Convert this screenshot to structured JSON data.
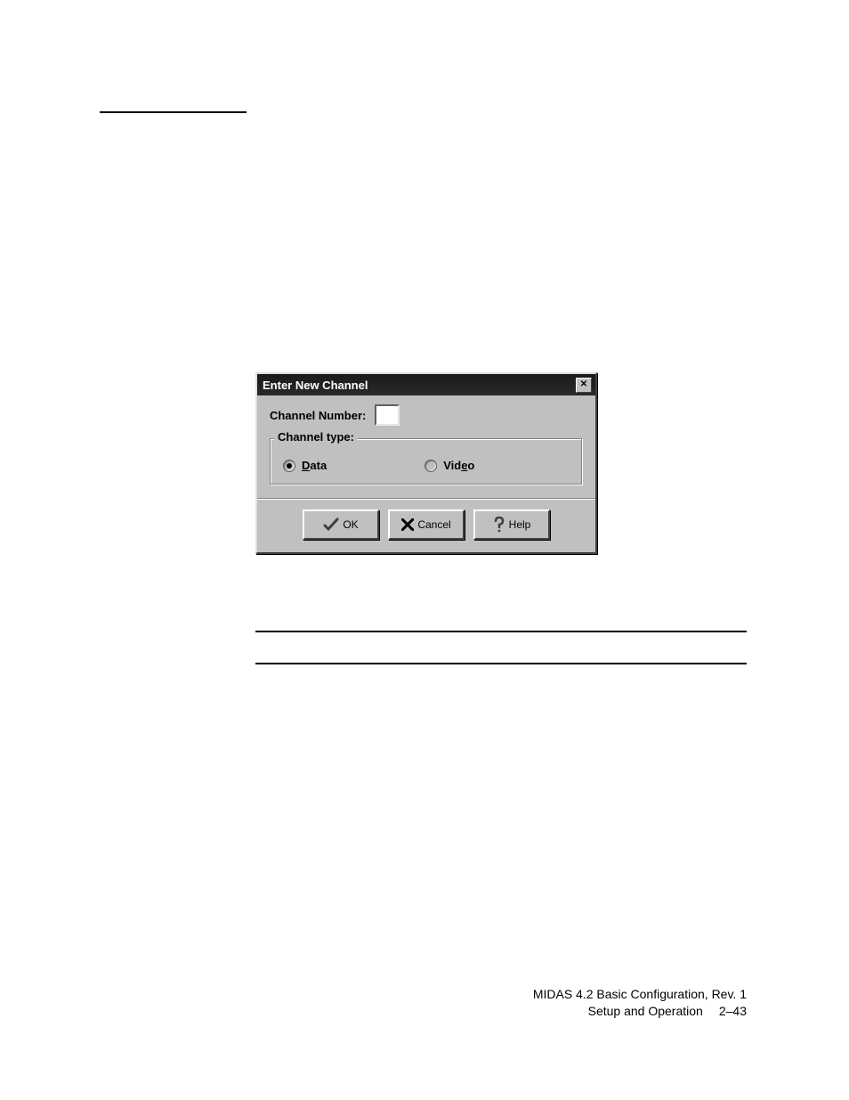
{
  "dialog": {
    "title": "Enter New Channel",
    "channel_number_label": "Channel Number:",
    "channel_number_value": "",
    "group_label": "Channel type:",
    "options": {
      "data": "Data",
      "video": "Video",
      "video_prefix": "Vid",
      "video_ul": "e",
      "video_suffix": "o"
    },
    "buttons": {
      "ok": "OK",
      "cancel": "Cancel",
      "help": "Help"
    }
  },
  "footer": {
    "line1": "MIDAS 4.2 Basic Configuration, Rev. 1",
    "line2a": "Setup and Operation",
    "line2b": "2–43"
  }
}
